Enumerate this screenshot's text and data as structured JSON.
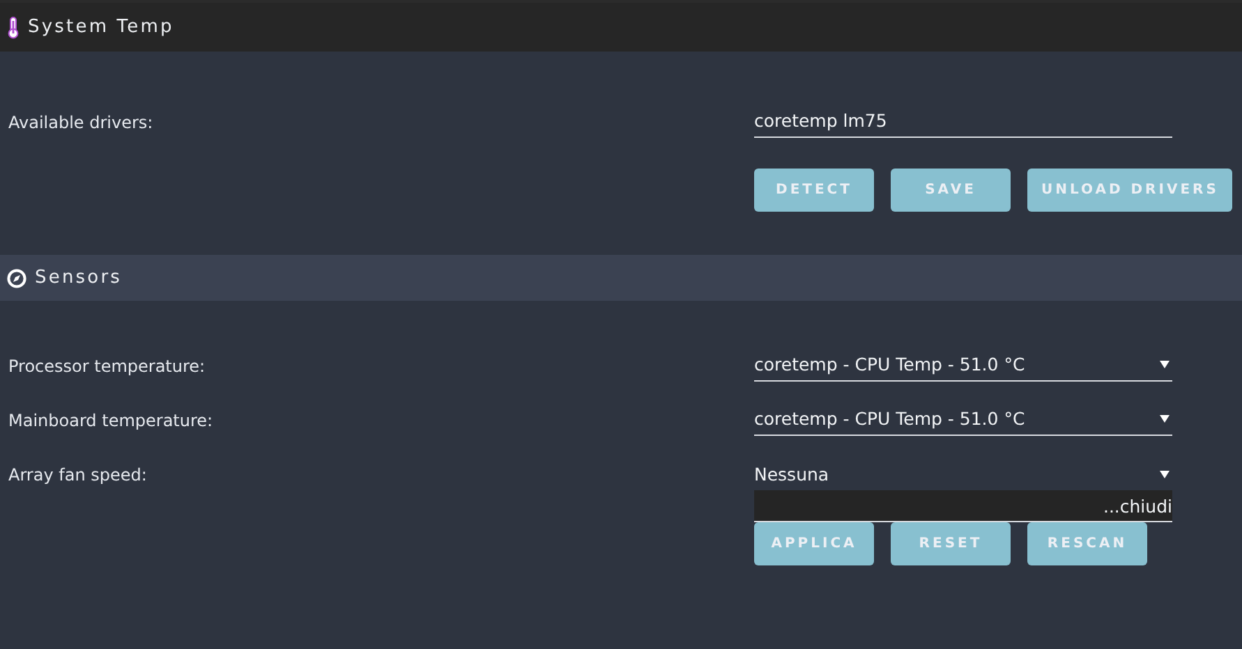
{
  "sections": [
    {
      "title": "System Temp",
      "kind": "thermometer",
      "rows": [
        {
          "kind": "input",
          "label": "Available drivers:",
          "value": "coretemp lm75"
        }
      ],
      "buttons": [
        "DETECT",
        "SAVE",
        "UNLOAD DRIVERS"
      ]
    },
    {
      "title": "Sensors",
      "kind": "compass",
      "rows": [
        {
          "kind": "select",
          "label": "Processor temperature:",
          "value": "coretemp - CPU Temp - 51.0 °C",
          "expanded": false
        },
        {
          "kind": "select",
          "label": "Mainboard temperature:",
          "value": "coretemp - CPU Temp - 51.0 °C",
          "expanded": false
        },
        {
          "kind": "select",
          "label": "Array fan speed:",
          "value": "Nessuna",
          "expanded": true,
          "options": [
            "...chiudi"
          ]
        }
      ],
      "buttons": [
        "APPLICA",
        "RESET",
        "RESCAN"
      ]
    }
  ]
}
